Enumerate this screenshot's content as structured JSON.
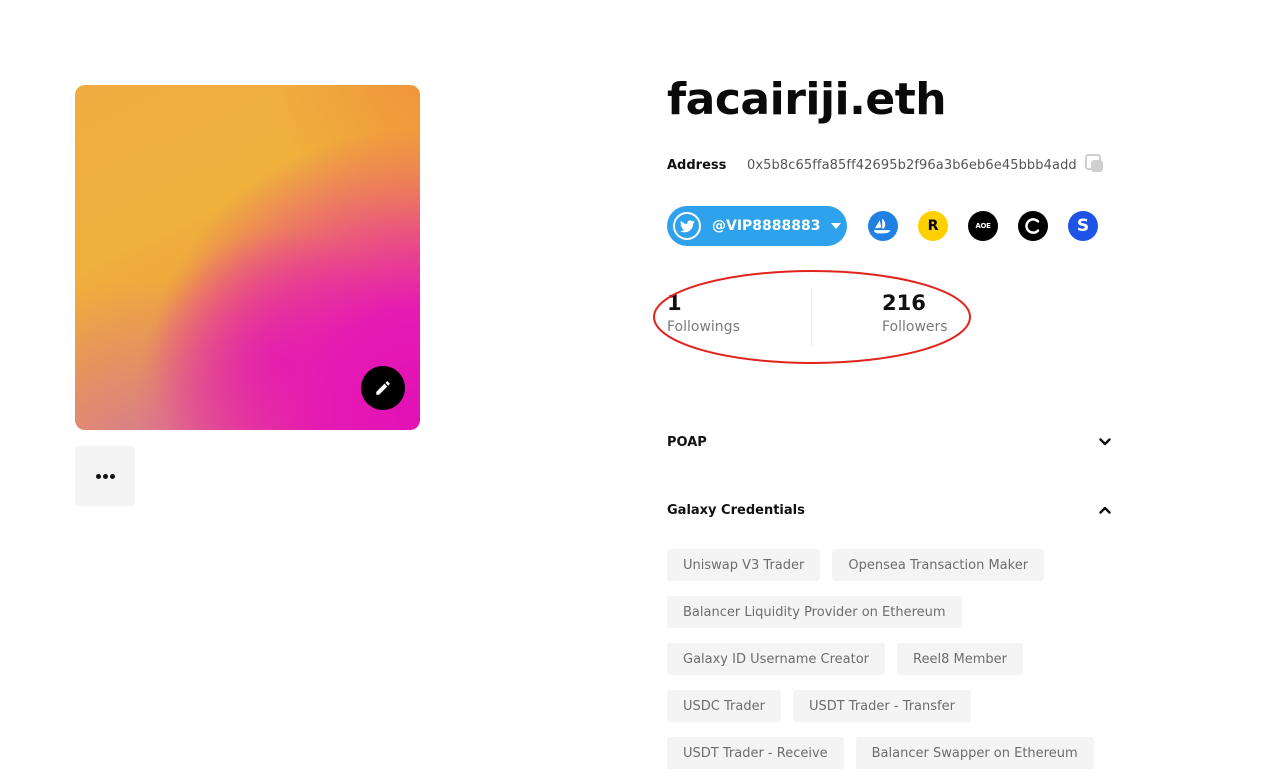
{
  "profile": {
    "ens_name": "facairiji.eth",
    "address_label": "Address",
    "address": "0x5b8c65ffa85ff42695b2f96a3b6eb6e45bbb4add"
  },
  "social": {
    "twitter_handle": "@VIP8888883",
    "icons": [
      "opensea-icon",
      "rarible-icon",
      "aoe-icon",
      "cyberconnect-icon",
      "stack-icon"
    ],
    "rarible_glyph": "R",
    "aoe_glyph": "AOE",
    "stack_glyph": "S",
    "twitter_color": "#2ea2ec"
  },
  "stats": {
    "followings_count": "1",
    "followings_label": "Followings",
    "followers_count": "216",
    "followers_label": "Followers"
  },
  "sections": {
    "poap_title": "POAP",
    "galaxy_title": "Galaxy Credentials"
  },
  "credentials": [
    [
      "Uniswap V3 Trader",
      "Opensea Transaction Maker"
    ],
    [
      "Balancer Liquidity Provider on Ethereum"
    ],
    [
      "Galaxy ID Username Creator",
      "Reel8 Member"
    ],
    [
      "USDC Trader",
      "USDT Trader - Transfer"
    ],
    [
      "USDT Trader - Receive",
      "Balancer Swapper on Ethereum"
    ]
  ],
  "annotation_color": "#e0241c"
}
